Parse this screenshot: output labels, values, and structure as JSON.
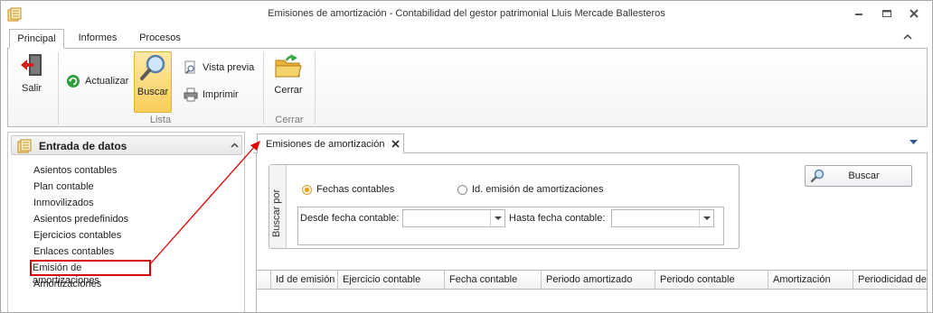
{
  "window": {
    "title": "Emisiones de amortización - Contabilidad del gestor patrimonial Lluis Mercade Ballesteros"
  },
  "ribbon": {
    "tabs": [
      {
        "label": "Principal",
        "active": true
      },
      {
        "label": "Informes",
        "active": false
      },
      {
        "label": "Procesos",
        "active": false
      }
    ],
    "salir_label": "Salir",
    "actualizar_label": "Actualizar",
    "buscar_label": "Buscar",
    "vista_previa_label": "Vista previa",
    "imprimir_label": "Imprimir",
    "cerrar_label": "Cerrar",
    "groups": {
      "lista": "Lista",
      "cerrar": "Cerrar"
    }
  },
  "left_panel": {
    "title": "Entrada de datos",
    "items": [
      "Asientos contables",
      "Plan contable",
      "Inmovilizados",
      "Asientos predefinidos",
      "Ejercicios contables",
      "Enlaces contables",
      "Emisión de amortizaciones",
      "Amortizaciones"
    ],
    "highlighted_item": "Emisión de amortizaciones"
  },
  "document": {
    "tab_label": "Emisiones de amortización",
    "search_group_label": "Buscar por",
    "radio_options": [
      {
        "label": "Fechas contables",
        "checked": true
      },
      {
        "label": "Id. emisión de amortizaciones",
        "checked": false
      }
    ],
    "desde_label": "Desde fecha contable:",
    "desde_value": "",
    "hasta_label": "Hasta fecha contable:",
    "hasta_value": "",
    "search_button_label": "Buscar",
    "grid_columns": [
      "Id de emisión",
      "Ejercicio contable",
      "Fecha contable",
      "Periodo amortizado",
      "Periodo contable",
      "Amortización",
      "Periodicidad de"
    ]
  },
  "colors": {
    "highlight_red": "#d80000",
    "ribbon_active_button": "#f8cd5a",
    "radio_checked": "#e3a21a"
  }
}
